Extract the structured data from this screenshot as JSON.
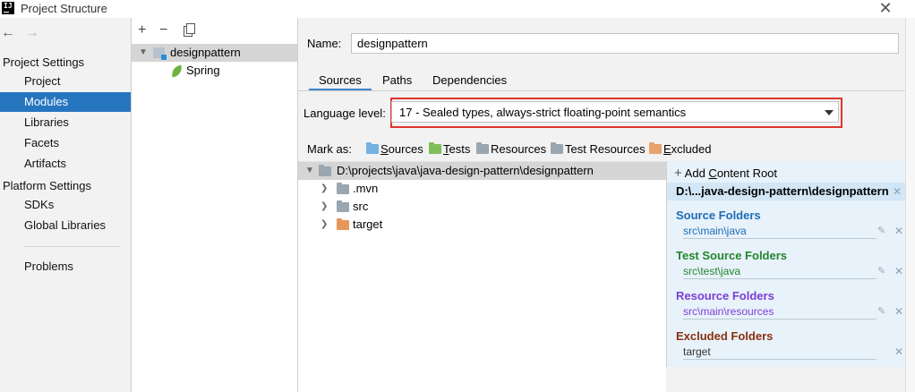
{
  "window": {
    "title": "Project Structure",
    "logo_text": "IJ"
  },
  "nav": {
    "section_project": "Project Settings",
    "project_items": [
      {
        "label": "Project"
      },
      {
        "label": "Modules"
      },
      {
        "label": "Libraries"
      },
      {
        "label": "Facets"
      },
      {
        "label": "Artifacts"
      }
    ],
    "section_platform": "Platform Settings",
    "platform_items": [
      {
        "label": "SDKs"
      },
      {
        "label": "Global Libraries"
      }
    ],
    "problems": "Problems",
    "selected": "Modules"
  },
  "modules": {
    "toolbar": {
      "add": "+",
      "remove": "−"
    },
    "tree": [
      {
        "label": "designpattern",
        "selected": true
      },
      {
        "label": "Spring"
      }
    ]
  },
  "main": {
    "name_label": "Name:",
    "name_value": "designpattern",
    "tabs": [
      {
        "label": "Sources",
        "active": true
      },
      {
        "label": "Paths"
      },
      {
        "label": "Dependencies"
      }
    ],
    "language_label": "Language level:",
    "language_value": "17 - Sealed types, always-strict floating-point semantics",
    "mark_as": {
      "label": "Mark as:",
      "buttons": [
        {
          "label": "Sources",
          "mnemonic": "S",
          "rest": "ources",
          "color": "#74b2e0"
        },
        {
          "label": "Tests",
          "mnemonic": "T",
          "rest": "ests",
          "color": "#7fbf5a"
        },
        {
          "label": "Resources",
          "mnemonic": "",
          "rest": "Resources",
          "color": "#9aa6b0"
        },
        {
          "label": "Test Resources",
          "mnemonic": "",
          "rest": "Test Resources",
          "color": "#9aa6b0"
        },
        {
          "label": "Excluded",
          "mnemonic": "E",
          "rest": "xcluded",
          "color": "#e8a26c"
        }
      ]
    }
  },
  "content_tree": {
    "root": "D:\\projects\\java\\java-design-pattern\\designpattern",
    "children": [
      {
        "label": ".mvn",
        "color": "#9aa6b0"
      },
      {
        "label": "src",
        "color": "#9aa6b0"
      },
      {
        "label": "target",
        "color": "#e8965a"
      }
    ]
  },
  "root_panel": {
    "add_label": "Add ",
    "add_mnemonic": "C",
    "add_rest": "ontent Root",
    "root_path": "D:\\...java-design-pattern\\designpattern",
    "groups": [
      {
        "title": "Source Folders",
        "entry": "src\\main\\java",
        "color": "#1d6cb6"
      },
      {
        "title": "Test Source Folders",
        "entry": "src\\test\\java",
        "color": "#23852e"
      },
      {
        "title": "Resource Folders",
        "entry": "src\\main\\resources",
        "color": "#7c3fd6"
      },
      {
        "title": "Excluded Folders",
        "entry": "target",
        "color": "#8a3010"
      }
    ]
  }
}
